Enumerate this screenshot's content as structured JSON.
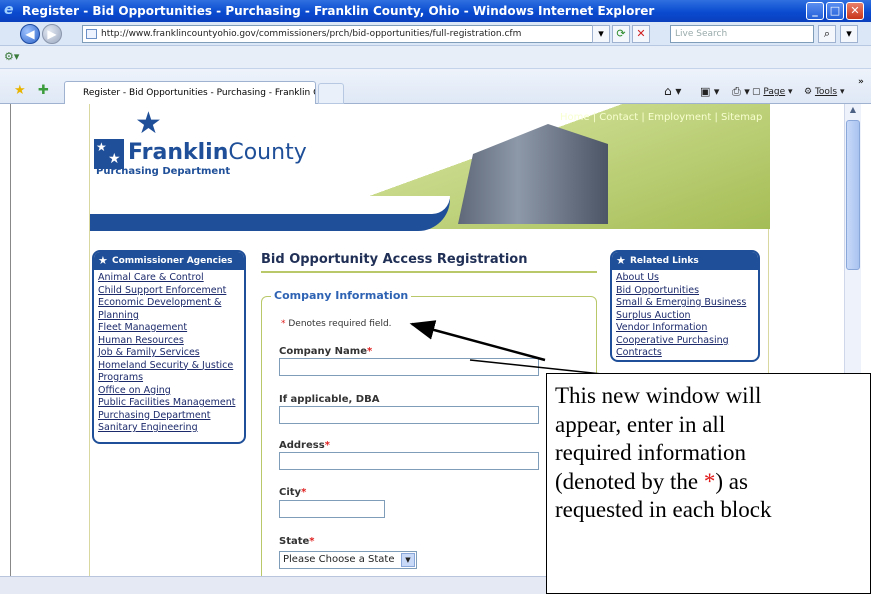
{
  "window": {
    "title": "Register - Bid Opportunities - Purchasing - Franklin County, Ohio - Windows Internet Explorer",
    "url": "http://www.franklincountyohio.gov/commissioners/prch/bid-opportunities/full-registration.cfm",
    "search_placeholder": "Live Search",
    "tab_label": "Register - Bid Opportunities - Purchasing - Franklin Co...",
    "page_menu": "Page",
    "tools_menu": "Tools"
  },
  "site": {
    "top_nav": "Home | Contact | Employment | Sitemap",
    "logo_bold": "Franklin",
    "logo_light": "County",
    "logo_sub": "Purchasing Department"
  },
  "left_box": {
    "title": "Commissioner Agencies",
    "items": [
      "Animal Care & Control",
      "Child Support Enforcement",
      "Economic Development &",
      "Planning",
      "Fleet Management",
      "Human Resources",
      "Job & Family Services",
      "Homeland Security & Justice",
      "Programs",
      "Office on Aging",
      "Public Facilities Management",
      "Purchasing Department",
      "Sanitary Engineering"
    ]
  },
  "right_box": {
    "title": "Related Links",
    "items": [
      "About Us",
      "Bid Opportunities",
      "Small & Emerging Business",
      "Surplus Auction",
      "Vendor Information",
      "Cooperative Purchasing",
      "Contracts"
    ]
  },
  "form": {
    "title": "Bid Opportunity Access Registration",
    "legend": "Company Information",
    "required_note": "Denotes required field.",
    "required_mark": "*",
    "company_name_label": "Company Name",
    "dba_label": "If applicable, DBA",
    "address_label": "Address",
    "city_label": "City",
    "state_label": "State",
    "state_value": "Please Choose a State"
  },
  "callout": {
    "line1": "This new window will",
    "line2": "appear, enter in all",
    "line3": "required information",
    "line4a": "(denoted by the ",
    "line4b": "*",
    "line4c": ") as",
    "line5": "requested in each block"
  }
}
